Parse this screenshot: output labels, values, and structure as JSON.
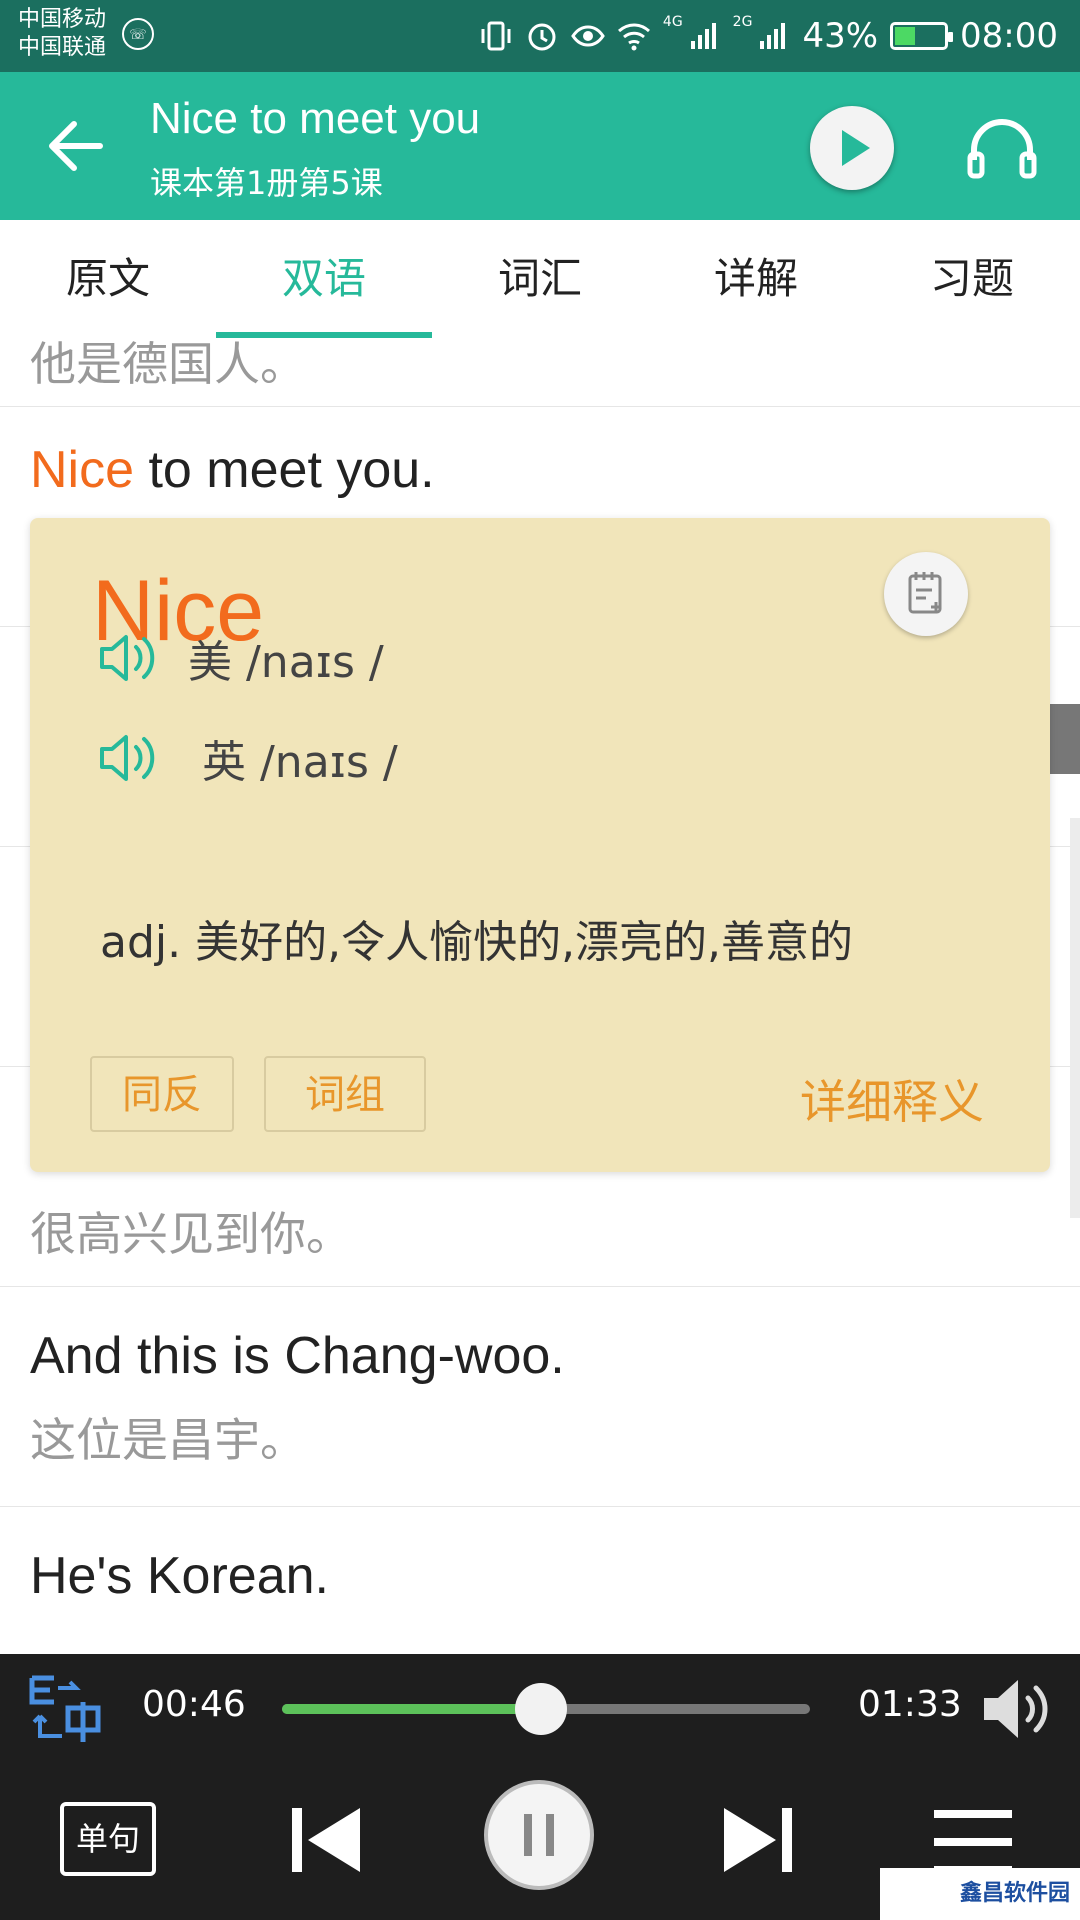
{
  "status_bar": {
    "carrier_1": "中国移动",
    "carrier_2": "中国联通",
    "net_1": "4G",
    "net_2": "2G",
    "battery": "43%",
    "battery_level": 0.43,
    "time": "08:00",
    "icons": [
      "vibrate-icon",
      "alarm-icon",
      "eye-icon",
      "wifi-icon",
      "signal-icon",
      "battery-icon"
    ]
  },
  "header": {
    "title": "Nice to meet you",
    "subtitle": "课本第1册第5课",
    "back_icon": "back-arrow-icon",
    "play_icon": "play-icon",
    "audio_icon": "headphones-icon"
  },
  "tabs": [
    {
      "label": "原文",
      "active": false
    },
    {
      "label": "双语",
      "active": true
    },
    {
      "label": "词汇",
      "active": false
    },
    {
      "label": "详解",
      "active": false
    },
    {
      "label": "习题",
      "active": false
    }
  ],
  "sentences": [
    {
      "en": "",
      "zh": "他是德国人。"
    },
    {
      "en_highlight": "Nice",
      "en_rest": " to meet you.",
      "zh": ""
    },
    {
      "en": "",
      "zh": "很高兴见到你。"
    },
    {
      "en": "And this is Chang-woo.",
      "zh": "这位是昌宇。"
    },
    {
      "en": "He's Korean.",
      "zh": ""
    }
  ],
  "popup": {
    "word": "Nice",
    "us_label": "美 /naɪs /",
    "uk_label": "英 /naɪs /",
    "definition": "adj. 美好的,令人愉快的,漂亮的,善意的",
    "btn_synonym": "同反",
    "btn_phrase": "词组",
    "btn_detail": "详细释义",
    "note_icon": "add-note-icon"
  },
  "player": {
    "current_time": "00:46",
    "total_time": "01:33",
    "progress": 0.49,
    "mode_label": "单句",
    "icons": [
      "bilingual-toggle-icon",
      "volume-icon",
      "previous-icon",
      "pause-icon",
      "next-icon",
      "menu-icon"
    ]
  },
  "colors": {
    "accent": "#26b99a",
    "status_bar": "#1b6f5f",
    "highlight": "#f26b1d",
    "popup_bg": "#f1e5ba",
    "popup_action": "#e8962b",
    "player_bg": "#1e1e1e",
    "progress": "#5cc15a"
  },
  "watermark": "鑫昌软件园"
}
